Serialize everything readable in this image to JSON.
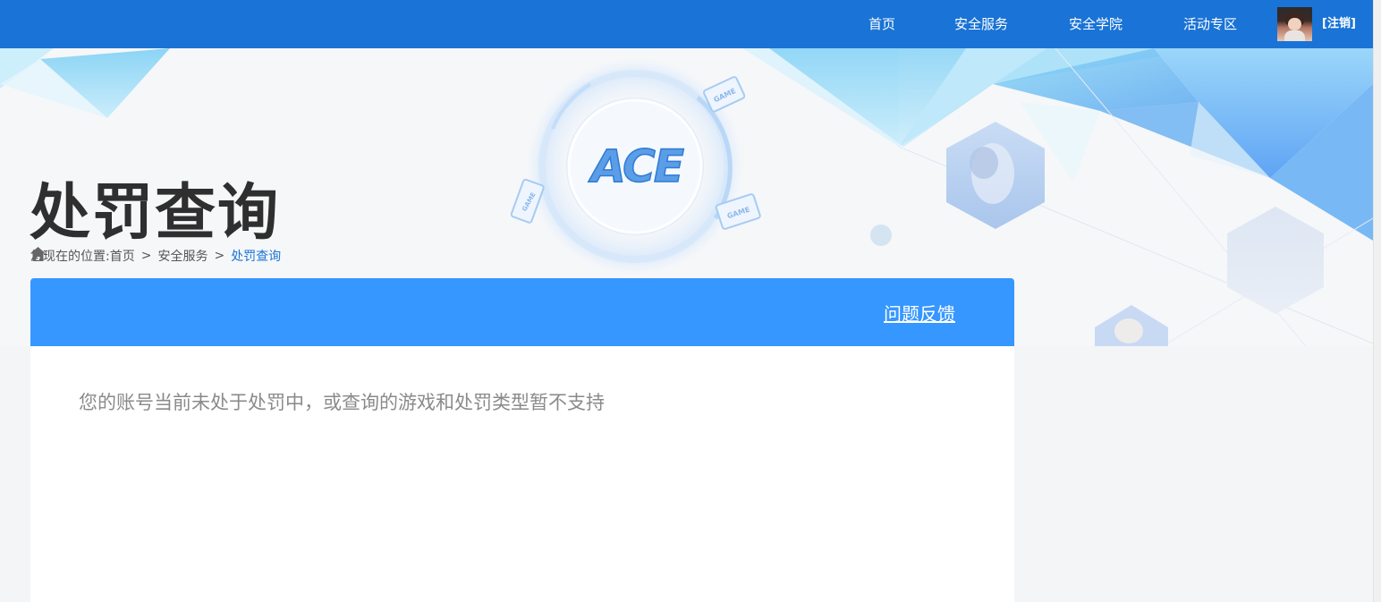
{
  "nav": {
    "items": [
      {
        "label": "首页"
      },
      {
        "label": "安全服务"
      },
      {
        "label": "安全学院"
      },
      {
        "label": "活动专区"
      }
    ],
    "logout": "[注销]"
  },
  "banner": {
    "logo_text": "ACE",
    "device_label": "GAME"
  },
  "page": {
    "title": "处罚查询"
  },
  "breadcrumb": {
    "prefix": "您现在的位置:",
    "items": [
      "首页",
      "安全服务",
      "处罚查询"
    ],
    "separator": ">"
  },
  "card": {
    "feedback": "问题反馈",
    "result": "您的账号当前未处于处罚中，或查询的游戏和处罚类型暂不支持"
  },
  "colors": {
    "topbar": "#1a73d6",
    "card_header": "#3597ff",
    "breadcrumb_active": "#1a73d6",
    "title": "#2f2f2f"
  }
}
